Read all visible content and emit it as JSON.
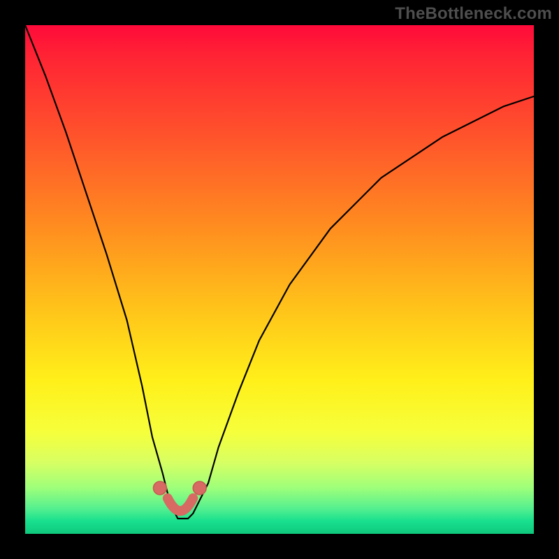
{
  "watermark": "TheBottleneck.com",
  "chart_data": {
    "type": "line",
    "title": "",
    "xlabel": "",
    "ylabel": "",
    "xlim": [
      0,
      100
    ],
    "ylim": [
      0,
      100
    ],
    "series": [
      {
        "name": "curve",
        "x": [
          0,
          4,
          8,
          12,
          16,
          20,
          23,
          25,
          27,
          28,
          29,
          30,
          31,
          32,
          33,
          34,
          36,
          38,
          42,
          46,
          52,
          60,
          70,
          82,
          94,
          100
        ],
        "values": [
          100,
          90,
          79,
          67,
          55,
          42,
          29,
          19,
          12,
          8,
          5,
          3,
          3,
          3,
          4,
          6,
          10,
          17,
          28,
          38,
          49,
          60,
          70,
          78,
          84,
          86
        ]
      }
    ],
    "markers": {
      "name": "threshold-dots",
      "color": "#d76a63",
      "u_shape": {
        "x": [
          28,
          33
        ],
        "y": 3
      },
      "points": [
        {
          "x": 26.5,
          "y": 9
        },
        {
          "x": 34.3,
          "y": 9
        }
      ]
    },
    "background_gradient": {
      "top_color": "#ff0a3a",
      "bottom_color": "#0fc87d",
      "stops": [
        "red",
        "orange",
        "yellow",
        "yellow-green",
        "green"
      ]
    }
  }
}
